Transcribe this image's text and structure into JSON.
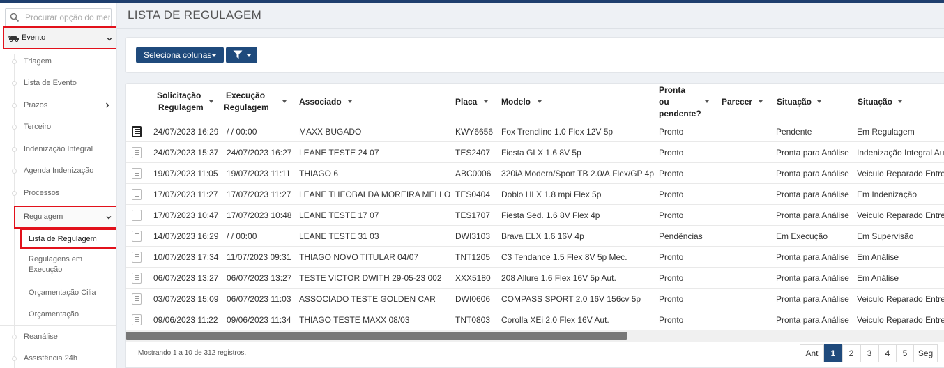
{
  "search": {
    "placeholder": "Procurar opção do menu"
  },
  "sidebar": {
    "evento_label": "Evento",
    "items": [
      {
        "label": "Triagem"
      },
      {
        "label": "Lista de Evento"
      },
      {
        "label": "Prazos"
      },
      {
        "label": "Terceiro"
      },
      {
        "label": "Indenização Integral"
      },
      {
        "label": "Agenda Indenização"
      },
      {
        "label": "Processos"
      }
    ],
    "regulagem_label": "Regulagem",
    "sub_items": [
      {
        "label": "Lista de Regulagem"
      },
      {
        "label": "Regulagens em Execução"
      },
      {
        "label": "Orçamentação Cilia"
      },
      {
        "label": "Orçamentação"
      }
    ],
    "bottom_items": [
      {
        "label": "Reanálise"
      },
      {
        "label": "Assistência 24h"
      }
    ]
  },
  "page": {
    "title": "LISTA DE REGULAGEM"
  },
  "toolbar": {
    "columns_label": "Seleciona colunas"
  },
  "table": {
    "headers": {
      "solicitacao": [
        "Solicitação",
        "Regulagem"
      ],
      "execucao": [
        "Execução",
        "Regulagem"
      ],
      "associado": "Associado",
      "placa": "Placa",
      "modelo": "Modelo",
      "pronta": [
        "Pronta",
        "ou",
        "pendente?"
      ],
      "parecer": "Parecer",
      "situacao1": "Situação",
      "situacao2": "Situação"
    },
    "rows": [
      {
        "solicitacao": "24/07/2023 16:29",
        "execucao": "/ / 00:00",
        "associado": "MAXX BUGADO",
        "placa": "KWY6656",
        "modelo": "Fox Trendline 1.0 Flex 12V 5p",
        "pronta": "Pronto",
        "parecer": "",
        "situacao1": "Pendente",
        "situacao2": "Em Regulagem"
      },
      {
        "solicitacao": "24/07/2023 15:37",
        "execucao": "24/07/2023 16:27",
        "associado": "LEANE TESTE 24 07",
        "placa": "TES2407",
        "modelo": "Fiesta GLX 1.6 8V 5p",
        "pronta": "Pronto",
        "parecer": "",
        "situacao1": "Pronta para Análise",
        "situacao2": "Indenização Integral Aut"
      },
      {
        "solicitacao": "19/07/2023 11:05",
        "execucao": "19/07/2023 11:11",
        "associado": "THIAGO 6",
        "placa": "ABC0006",
        "modelo": "320iA Modern/Sport TB 2.0/A.Flex/GP 4p",
        "pronta": "Pronto",
        "parecer": "",
        "situacao1": "Pronta para Análise",
        "situacao2": "Veiculo Reparado Entreg"
      },
      {
        "solicitacao": "17/07/2023 11:27",
        "execucao": "17/07/2023 11:27",
        "associado": "LEANE THEOBALDA MOREIRA MELLO",
        "placa": "TES0404",
        "modelo": "Doblo HLX 1.8 mpi Flex 5p",
        "pronta": "Pronto",
        "parecer": "",
        "situacao1": "Pronta para Análise",
        "situacao2": "Em Indenização"
      },
      {
        "solicitacao": "17/07/2023 10:47",
        "execucao": "17/07/2023 10:48",
        "associado": "LEANE TESTE 17 07",
        "placa": "TES1707",
        "modelo": "Fiesta Sed. 1.6 8V Flex 4p",
        "pronta": "Pronto",
        "parecer": "",
        "situacao1": "Pronta para Análise",
        "situacao2": "Veiculo Reparado Entreg"
      },
      {
        "solicitacao": "14/07/2023 16:29",
        "execucao": "/ / 00:00",
        "associado": "LEANE TESTE 31 03",
        "placa": "DWI3103",
        "modelo": "Brava ELX 1.6 16V 4p",
        "pronta": "Pendências",
        "parecer": "",
        "situacao1": "Em Execução",
        "situacao2": "Em Supervisão"
      },
      {
        "solicitacao": "10/07/2023 17:34",
        "execucao": "11/07/2023 09:31",
        "associado": "THIAGO NOVO TITULAR 04/07",
        "placa": "TNT1205",
        "modelo": "C3 Tendance 1.5 Flex 8V 5p Mec.",
        "pronta": "Pronto",
        "parecer": "",
        "situacao1": "Pronta para Análise",
        "situacao2": "Em Análise"
      },
      {
        "solicitacao": "06/07/2023 13:27",
        "execucao": "06/07/2023 13:27",
        "associado": "TESTE VICTOR DWITH 29-05-23 002",
        "placa": "XXX5180",
        "modelo": "208 Allure 1.6 Flex 16V 5p Aut.",
        "pronta": "Pronto",
        "parecer": "",
        "situacao1": "Pronta para Análise",
        "situacao2": "Em Análise"
      },
      {
        "solicitacao": "03/07/2023 15:09",
        "execucao": "06/07/2023 11:03",
        "associado": "ASSOCIADO TESTE GOLDEN CAR",
        "placa": "DWI0606",
        "modelo": "COMPASS SPORT 2.0 16V 156cv 5p",
        "pronta": "Pronto",
        "parecer": "",
        "situacao1": "Pronta para Análise",
        "situacao2": "Veiculo Reparado Entreg"
      },
      {
        "solicitacao": "09/06/2023 11:22",
        "execucao": "09/06/2023 11:34",
        "associado": "THIAGO TESTE MAXX 08/03",
        "placa": "TNT0803",
        "modelo": "Corolla XEi 2.0 Flex 16V Aut.",
        "pronta": "Pronto",
        "parecer": "",
        "situacao1": "Pronta para Análise",
        "situacao2": "Veiculo Reparado Entreg"
      }
    ],
    "footer_info": "Mostrando 1 a 10 de 312 registros."
  },
  "pagination": {
    "prev_label": "Ant",
    "pages": [
      "1",
      "2",
      "3",
      "4",
      "5"
    ],
    "active": "1",
    "next_label": "Seg"
  },
  "colors": {
    "accent": "#1f4a7c",
    "highlight": "#e2111b",
    "topbar": "#1f3f6e"
  }
}
